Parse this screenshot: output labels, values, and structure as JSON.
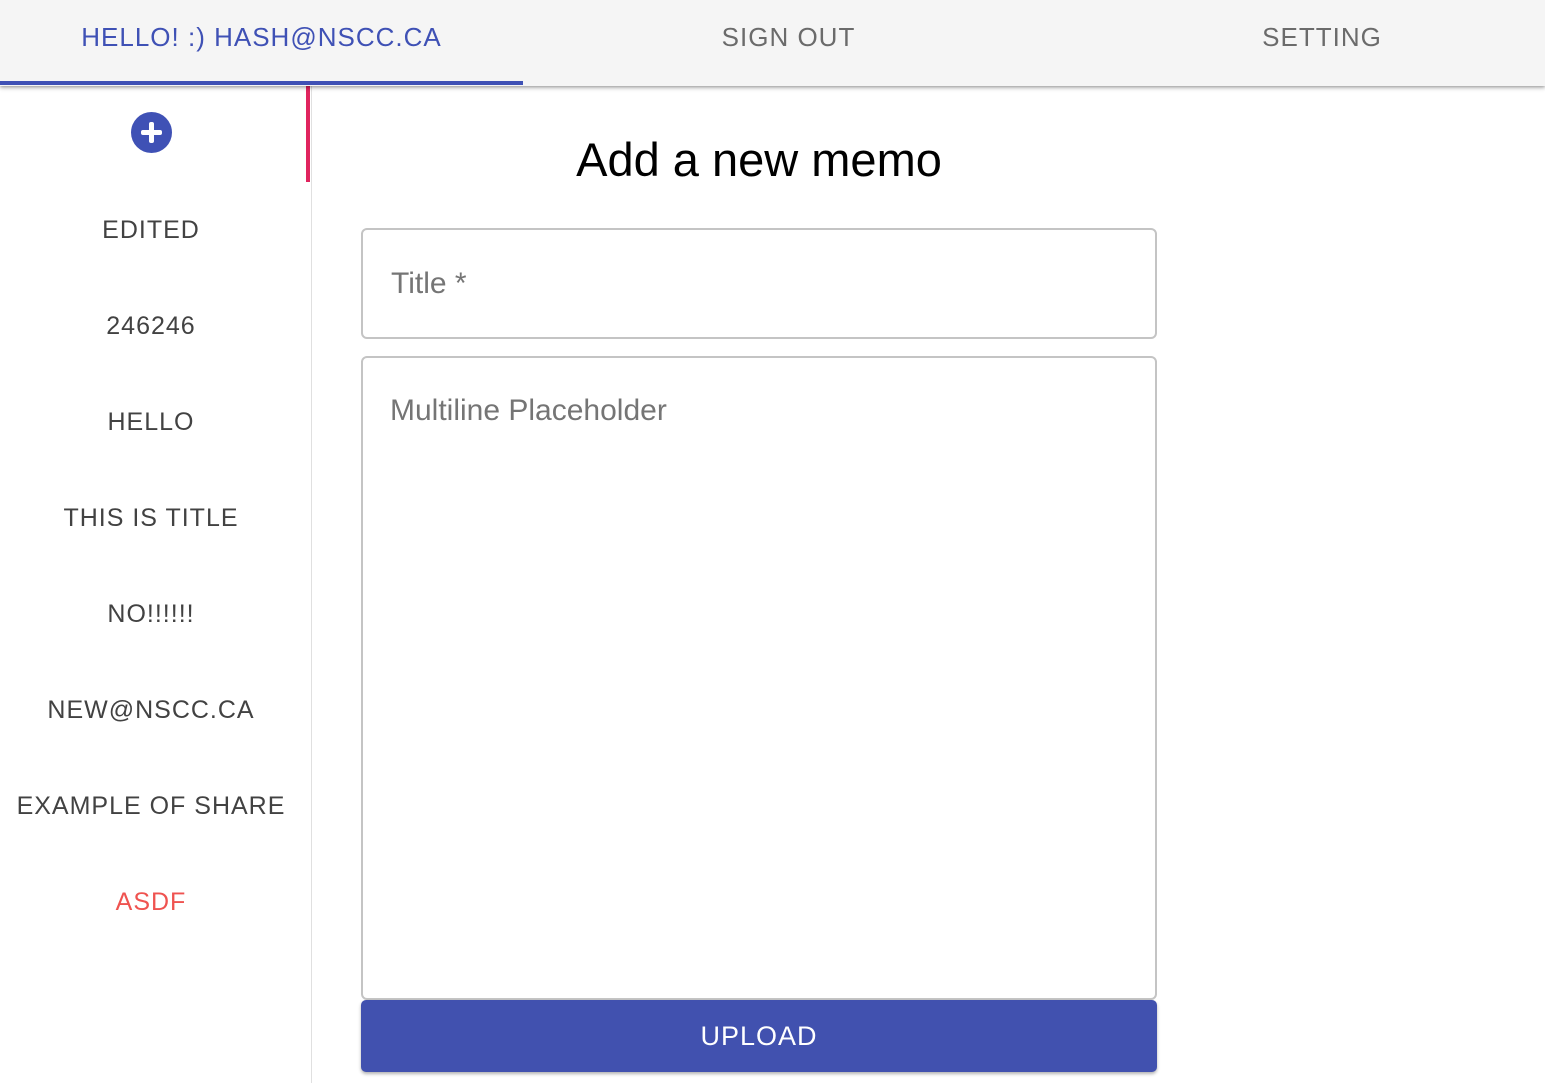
{
  "tabs": [
    {
      "label": "HELLO! :) HASH@NSCC.CA",
      "active": true
    },
    {
      "label": "SIGN OUT",
      "active": false
    },
    {
      "label": "SETTING",
      "active": false
    }
  ],
  "sidebar": {
    "add_icon": "plus-circle-icon",
    "items": [
      {
        "label": "EDITED"
      },
      {
        "label": "246246"
      },
      {
        "label": "HELLO"
      },
      {
        "label": "THIS IS TITLE"
      },
      {
        "label": "NO!!!!!!"
      },
      {
        "label": "NEW@NSCC.CA"
      },
      {
        "label": "EXAMPLE OF SHARE"
      },
      {
        "label": "ASDF"
      }
    ]
  },
  "main": {
    "heading": "Add a new memo",
    "title_field": {
      "placeholder": "Title *",
      "value": ""
    },
    "body_field": {
      "placeholder": "Multiline Placeholder",
      "value": ""
    },
    "upload_label": "UPLOAD"
  },
  "colors": {
    "primary": "#3f51b5",
    "secondary_indicator": "#e0245e",
    "highlight_item": "#ef5350"
  }
}
